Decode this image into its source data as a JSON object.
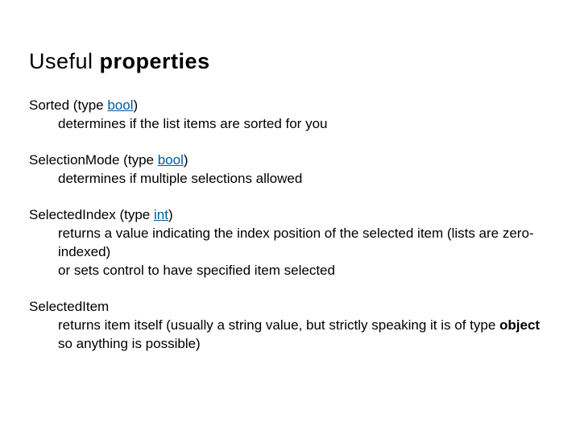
{
  "title": {
    "prefix": "Useful ",
    "emph": "properties"
  },
  "props": [
    {
      "head_before": "Sorted (type ",
      "type_kw": "bool",
      "head_after": ")",
      "descs": [
        "determines if the list items are sorted for you"
      ]
    },
    {
      "head_before": "SelectionMode (type ",
      "type_kw": "bool",
      "head_after": ")",
      "descs": [
        "determines if multiple selections allowed"
      ]
    },
    {
      "head_before": "SelectedIndex (type ",
      "type_kw": "int",
      "head_after": ")",
      "descs": [
        "returns a value indicating the index position of the selected item (lists are zero-indexed)",
        "or sets control to have specified item selected"
      ]
    },
    {
      "head_before": "SelectedItem",
      "type_kw": "",
      "head_after": "",
      "descs_rich": {
        "before": "returns item itself (usually a string value, but strictly speaking it is of type ",
        "bold": "object",
        "after": " so anything is possible)"
      }
    }
  ]
}
